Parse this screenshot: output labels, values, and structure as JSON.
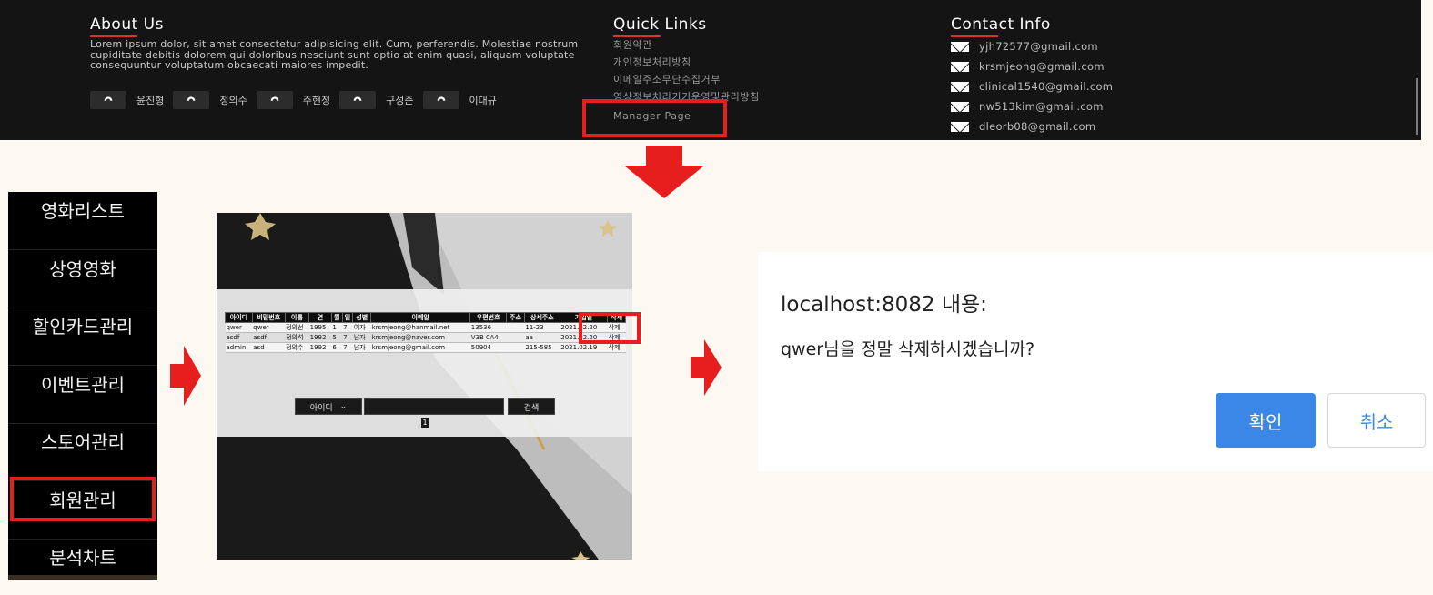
{
  "footer": {
    "about": {
      "title": "About Us",
      "text": "Lorem ipsum dolor, sit amet consectetur adipisicing elit. Cum, perferendis. Molestiae nostrum cupiditate debitis dolorem qui doloribus nesciunt sunt optio at enim quasi, aliquam voluptate consequuntur voluptatum obcaecati maiores impedit.",
      "members": [
        {
          "name": "윤진형",
          "icon": "github-icon"
        },
        {
          "name": "정의수",
          "icon": "github-icon"
        },
        {
          "name": "주현정",
          "icon": "github-icon"
        },
        {
          "name": "구성준",
          "icon": "github-icon"
        },
        {
          "name": "이대규",
          "icon": "github-icon"
        }
      ]
    },
    "quick_links": {
      "title": "Quick Links",
      "items": [
        "회원약관",
        "개인정보처리방침",
        "이메일주소무단수집거부",
        "영상정보처리기기운영및관리방침",
        "Manager Page"
      ]
    },
    "contact": {
      "title": "Contact Info",
      "emails": [
        "yjh72577@gmail.com",
        "krsmjeong@gmail.com",
        "clinical1540@gmail.com",
        "nw513kim@gmail.com",
        "dleorb08@gmail.com"
      ]
    }
  },
  "admin_menu": {
    "items": [
      "영화리스트",
      "상영영화",
      "할인카드관리",
      "이벤트관리",
      "스토어관리",
      "회원관리",
      "분석차트"
    ],
    "selected": "회원관리"
  },
  "member_admin": {
    "columns": [
      "아이디",
      "비밀번호",
      "이름",
      "연",
      "월",
      "일",
      "성별",
      "이메일",
      "우편번호",
      "주소",
      "상세주소",
      "가입일",
      "삭제"
    ],
    "rows": [
      [
        "qwer",
        "qwer",
        "정의선",
        "1995",
        "1",
        "7",
        "여자",
        "krsmjeong@hanmail.net",
        "13536",
        "",
        "11-23",
        "2021.02.20",
        "삭제"
      ],
      [
        "asdf",
        "asdf",
        "정의석",
        "1992",
        "5",
        "7",
        "남자",
        "krsmjeong@naver.com",
        "V3B 0A4",
        "",
        "aa",
        "2021.02.20",
        "삭제"
      ],
      [
        "admin",
        "asd",
        "정의수",
        "1992",
        "6",
        "7",
        "남자",
        "krsmjeong@gmail.com",
        "50904",
        "",
        "215-585",
        "2021.02.19",
        "삭제"
      ]
    ],
    "search": {
      "select_value": "아이디",
      "input_value": "",
      "button_label": "검색"
    },
    "page": "1"
  },
  "dialog": {
    "title": "localhost:8082 내용:",
    "message": "qwer님을 정말 삭제하시겠습니까?",
    "ok_label": "확인",
    "cancel_label": "취소"
  },
  "colors": {
    "highlight_red": "#e61e1e",
    "dialog_accent": "#3a87e8",
    "footer_bg": "#141414",
    "page_bg": "#fdf8f1"
  }
}
